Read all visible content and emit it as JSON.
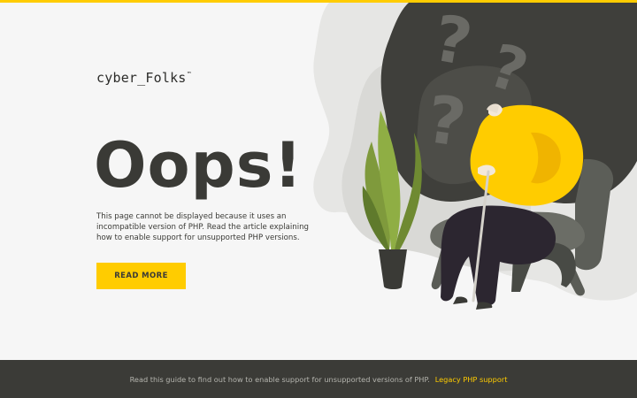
{
  "brand": {
    "logo_text": "cyber_Folks",
    "logo_mark": "™"
  },
  "main": {
    "headline": "Oops!",
    "description": "This page cannot be displayed because it uses an incompatible version of PHP. Read the article explaining how to enable support for unsupported PHP versions.",
    "read_more_label": "READ MORE"
  },
  "footer": {
    "text": "Read this guide to find out how to enable support for unsupported versions of PHP.",
    "link_label": "Legacy PHP support"
  },
  "colors": {
    "accent": "#ffcc00",
    "dark": "#3b3b37",
    "background": "#f6f6f6"
  },
  "icons": {
    "illustration": "confused-person-illustration",
    "question_marks": "question-mark-icon"
  }
}
